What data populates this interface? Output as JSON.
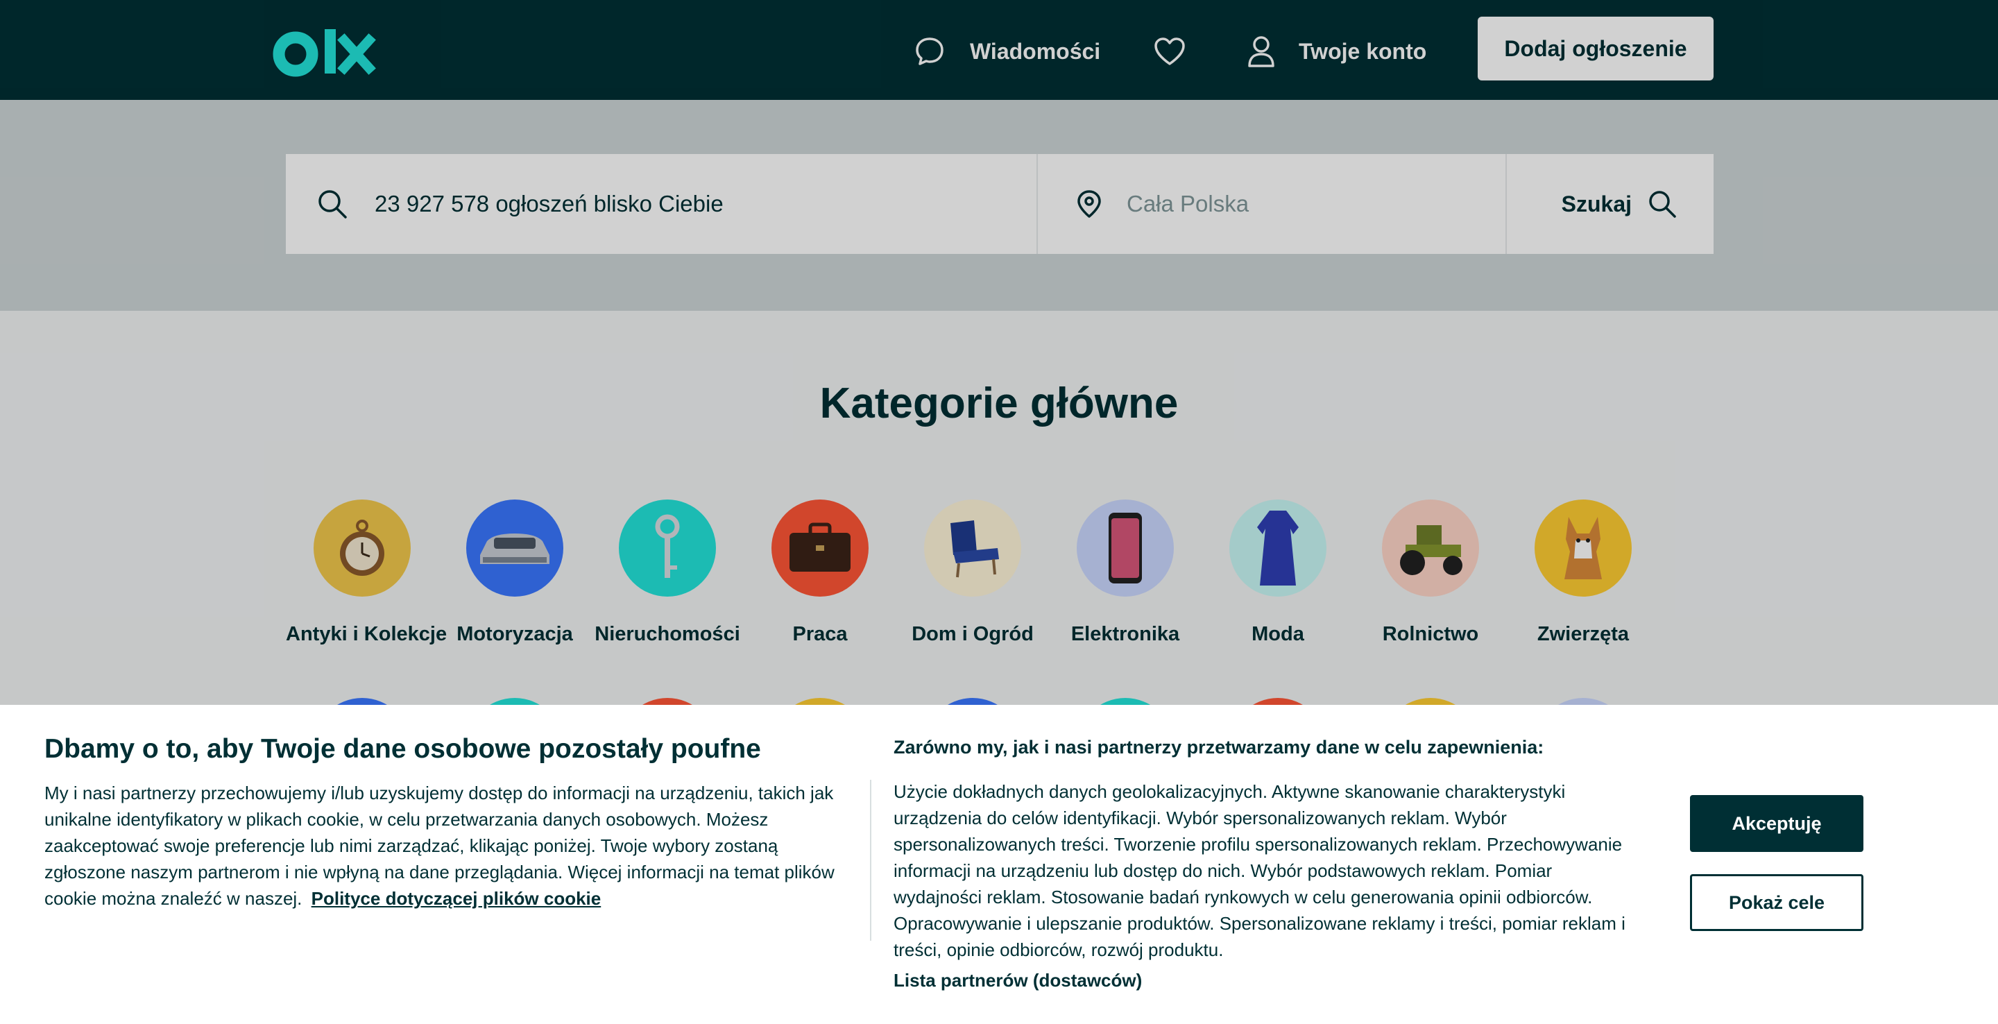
{
  "header": {
    "logo_text": "olx",
    "messages_label": "Wiadomości",
    "account_label": "Twoje konto",
    "add_button_label": "Dodaj ogłoszenie"
  },
  "search": {
    "query_placeholder": "23 927 578 ogłoszeń blisko Ciebie",
    "location_placeholder": "Cała Polska",
    "button_label": "Szukaj"
  },
  "categories": {
    "title": "Kategorie główne",
    "items": [
      {
        "label": "Antyki i Kolekcje",
        "color": "#f2c94c",
        "icon": "pocket-watch-icon"
      },
      {
        "label": "Motoryzacja",
        "color": "#3a77ff",
        "icon": "car-icon"
      },
      {
        "label": "Nieruchomości",
        "color": "#23e5db",
        "icon": "key-icon"
      },
      {
        "label": "Praca",
        "color": "#ff5636",
        "icon": "briefcase-icon"
      },
      {
        "label": "Dom i Ogród",
        "color": "#fff6d9",
        "icon": "armchair-icon"
      },
      {
        "label": "Elektronika",
        "color": "#cbd8ff",
        "icon": "smartphone-icon"
      },
      {
        "label": "Moda",
        "color": "#c8f8f6",
        "icon": "dress-icon"
      },
      {
        "label": "Rolnictwo",
        "color": "#ffd6c9",
        "icon": "tractor-icon"
      },
      {
        "label": "Zwierzęta",
        "color": "#ffce32",
        "icon": "dog-icon"
      }
    ]
  },
  "cookie": {
    "title": "Dbamy o to, aby Twoje dane osobowe pozostały poufne",
    "text": "My i nasi partnerzy przechowujemy i/lub uzyskujemy dostęp do informacji na urządzeniu, takich jak unikalne identyfikatory w plikach cookie, w celu przetwarzania danych osobowych. Możesz zaakceptować swoje preferencje lub nimi zarządzać, klikając poniżej. Twoje wybory zostaną zgłoszone naszym partnerom i nie wpłyną na dane przeglądania. Więcej informacji na temat plików cookie można znaleźć w naszej.",
    "policy_link": "Polityce dotyczącej plików cookie",
    "right_title": "Zarówno my, jak i nasi partnerzy przetwarzamy dane w celu zapewnienia:",
    "right_text": "Użycie dokładnych danych geolokalizacyjnych. Aktywne skanowanie charakterystyki urządzenia do celów identyfikacji. Wybór spersonalizowanych reklam. Wybór spersonalizowanych treści. Tworzenie profilu spersonalizowanych reklam. Przechowywanie informacji na urządzeniu lub dostęp do nich. Wybór podstawowych reklam. Pomiar wydajności reklam. Stosowanie badań rynkowych w celu generowania opinii odbiorców. Opracowywanie i ulepszanie produktów. Spersonalizowane reklamy i treści, pomiar reklam i treści, opinie odbiorców, rozwój produktu.",
    "partners_link": "Lista partnerów (dostawców)",
    "accept_label": "Akceptuję",
    "goals_label": "Pokaż cele"
  },
  "colors": {
    "brand_dark": "#002f34",
    "brand_teal": "#23e5db",
    "search_band": "#ced6d7"
  }
}
